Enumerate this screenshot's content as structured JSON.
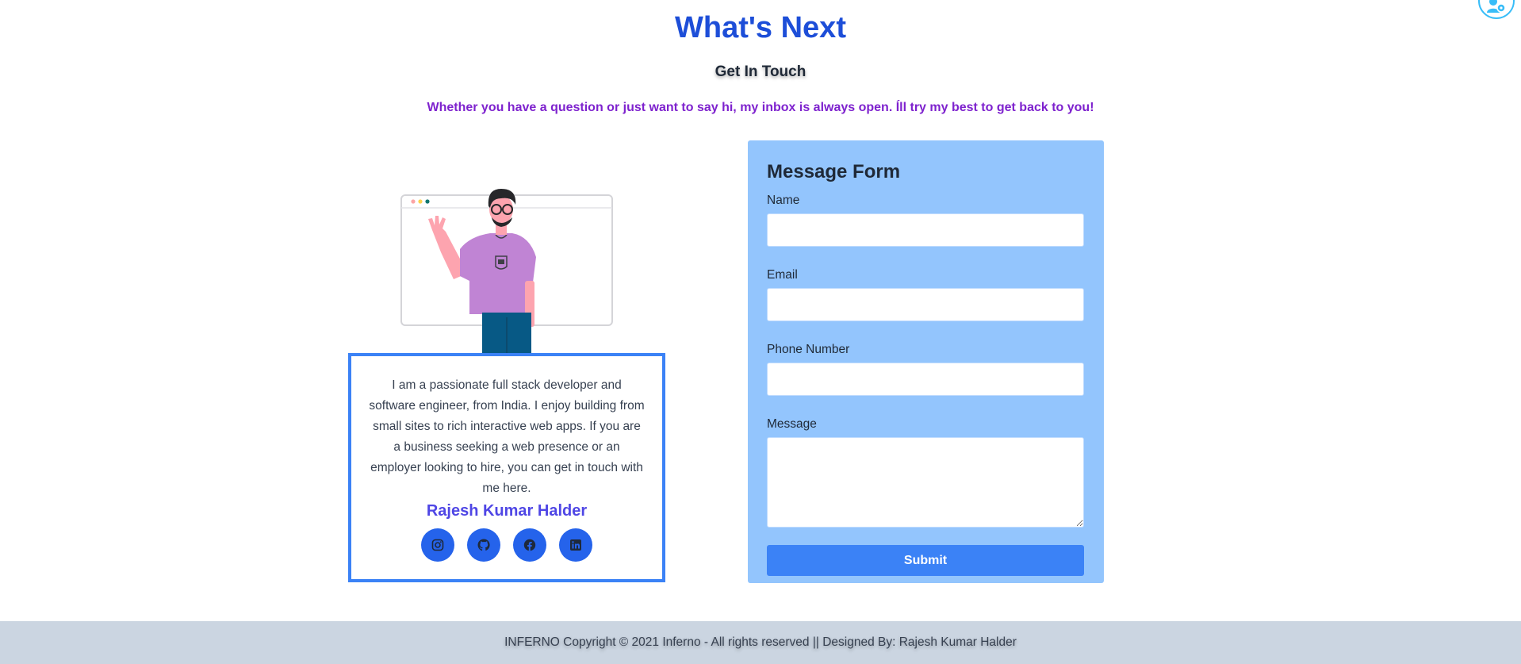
{
  "header": {
    "title": "What's Next",
    "subtitle": "Get In Touch",
    "lead": "Whether you have a question or just want to say hi, my inbox is always open. Íll try my best to get back to you!"
  },
  "corner_button": {
    "icon": "user-settings-icon"
  },
  "about": {
    "bio": "I am a passionate full stack developer and software engineer, from India. I enjoy building from small sites to rich interactive web apps. If you are a business seeking a web presence or an employer looking to hire, you can get in touch with me here.",
    "name": "Rajesh Kumar Halder",
    "socials": [
      {
        "icon": "instagram-icon"
      },
      {
        "icon": "github-icon"
      },
      {
        "icon": "facebook-icon"
      },
      {
        "icon": "linkedin-icon"
      }
    ]
  },
  "form": {
    "title": "Message Form",
    "name_label": "Name",
    "name_value": "",
    "email_label": "Email",
    "email_value": "",
    "phone_label": "Phone Number",
    "phone_value": "",
    "message_label": "Message",
    "message_value": "",
    "submit_label": "Submit"
  },
  "footer": {
    "text": "INFERNO Copyright © 2021 Inferno - All rights reserved || Designed By: Rajesh Kumar Halder"
  },
  "colors": {
    "title": "#1d4ed8",
    "lead": "#7e22ce",
    "name": "#4f46e5",
    "card_border": "#3b82f6",
    "form_bg": "#93c5fd",
    "submit_bg": "#3b82f6",
    "social_bg": "#2563eb",
    "footer_bg": "#cbd5e1"
  }
}
